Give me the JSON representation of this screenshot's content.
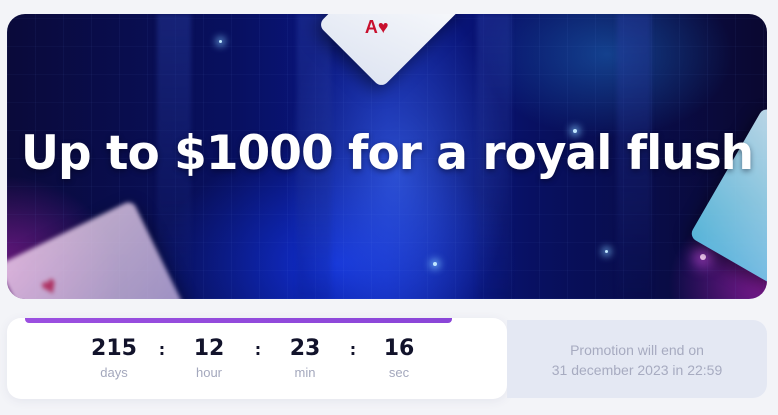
{
  "banner": {
    "title": "Up to $1000 for a royal flush"
  },
  "countdown": {
    "progress": 0.92,
    "units": [
      {
        "value": "215",
        "label": "days"
      },
      {
        "value": "12",
        "label": "hour"
      },
      {
        "value": "23",
        "label": "min"
      },
      {
        "value": "16",
        "label": "sec"
      }
    ],
    "separator": ":"
  },
  "promotion": {
    "ends_label": "Promotion will end on",
    "ends_date": "31 december 2023 in 22:59"
  },
  "colors": {
    "accent": "#9b4fe0",
    "text_dark": "#12132b",
    "text_muted": "#a4a8bd"
  },
  "icons": [
    "playing-card-icon"
  ]
}
